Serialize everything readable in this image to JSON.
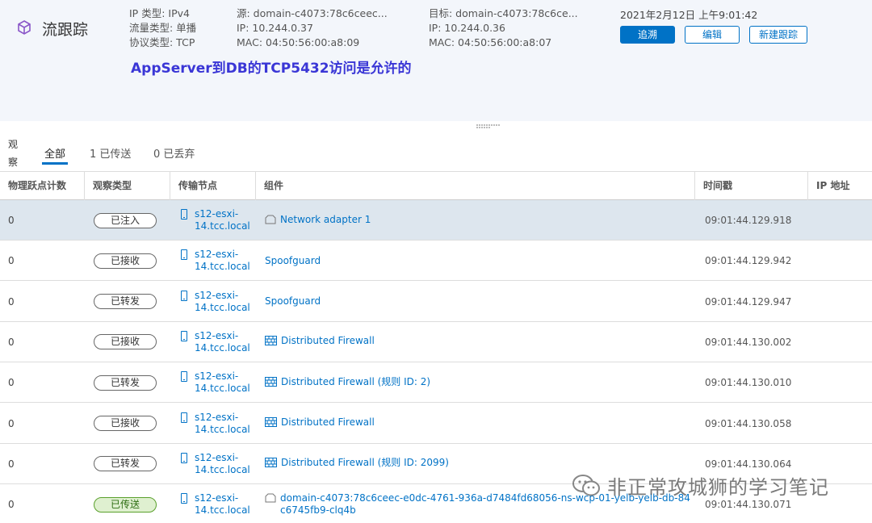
{
  "header": {
    "title": "流跟踪",
    "ip_type": "IP 类型: IPv4",
    "traffic_type": "流量类型: 单播",
    "protocol_type": "协议类型: TCP",
    "source": {
      "name": "源: domain-c4073:78c6ceec...",
      "ip": "IP: 10.244.0.37",
      "mac": "MAC: 04:50:56:00:a8:09"
    },
    "destination": {
      "name": "目标: domain-c4073:78c6ce...",
      "ip": "IP: 10.244.0.36",
      "mac": "MAC: 04:50:56:00:a8:07"
    },
    "timestamp": "2021年2月12日 上午9:01:42",
    "buttons": {
      "retrace": "追溯",
      "edit": "编辑",
      "new_trace": "新建跟踪"
    },
    "annotation": "AppServer到DB的TCP5432访问是允许的"
  },
  "observations": {
    "label": "观察",
    "tabs": {
      "all": "全部",
      "delivered": "1 已传送",
      "dropped": "0 已丢弃"
    }
  },
  "table": {
    "columns": {
      "hop_count": "物理跃点计数",
      "obs_type": "观察类型",
      "transport_node": "传输节点",
      "component": "组件",
      "timestamp": "时间戳",
      "ip_address": "IP 地址"
    },
    "rows": [
      {
        "hop": "0",
        "type": "已注入",
        "node": "s12-esxi-14.tcc.local",
        "component": "Network adapter 1",
        "icon": "network-adapter-icon",
        "time": "09:01:44.129.918",
        "ip": "",
        "selected": true,
        "green": false
      },
      {
        "hop": "0",
        "type": "已接收",
        "node": "s12-esxi-14.tcc.local",
        "component": "Spoofguard",
        "icon": "none",
        "time": "09:01:44.129.942",
        "ip": "",
        "selected": false,
        "green": false
      },
      {
        "hop": "0",
        "type": "已转发",
        "node": "s12-esxi-14.tcc.local",
        "component": "Spoofguard",
        "icon": "none",
        "time": "09:01:44.129.947",
        "ip": "",
        "selected": false,
        "green": false
      },
      {
        "hop": "0",
        "type": "已接收",
        "node": "s12-esxi-14.tcc.local",
        "component": "Distributed Firewall",
        "icon": "firewall-icon",
        "time": "09:01:44.130.002",
        "ip": "",
        "selected": false,
        "green": false
      },
      {
        "hop": "0",
        "type": "已转发",
        "node": "s12-esxi-14.tcc.local",
        "component": "Distributed Firewall (规则 ID: 2)",
        "icon": "firewall-icon",
        "time": "09:01:44.130.010",
        "ip": "",
        "selected": false,
        "green": false
      },
      {
        "hop": "0",
        "type": "已接收",
        "node": "s12-esxi-14.tcc.local",
        "component": "Distributed Firewall",
        "icon": "firewall-icon",
        "time": "09:01:44.130.058",
        "ip": "",
        "selected": false,
        "green": false
      },
      {
        "hop": "0",
        "type": "已转发",
        "node": "s12-esxi-14.tcc.local",
        "component": "Distributed Firewall (规则 ID: 2099)",
        "icon": "firewall-icon",
        "time": "09:01:44.130.064",
        "ip": "",
        "selected": false,
        "green": false
      },
      {
        "hop": "0",
        "type": "已传送",
        "node": "s12-esxi-14.tcc.local",
        "component": "domain-c4073:78c6ceec-e0dc-4761-936a-d7484fd68056-ns-wcp-01-yelb-yelb-db-84c6745fb9-clq4b",
        "icon": "network-adapter-icon",
        "time": "09:01:44.130.071",
        "ip": "",
        "selected": false,
        "green": true
      }
    ]
  },
  "watermark": {
    "text": "非正常攻城狮的学习笔记",
    "icon": "wechat-icon"
  },
  "colors": {
    "accent": "#0072c6",
    "annotation": "#3a36d6",
    "header_bg": "#f3f6fb",
    "selected_row": "#dde6ee",
    "delivered_badge": "#dff0d0"
  }
}
